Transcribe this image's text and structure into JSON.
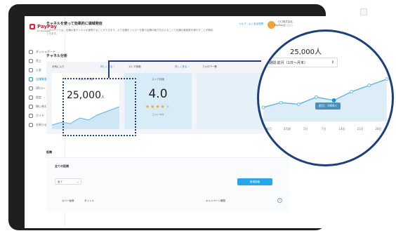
{
  "brand": {
    "name": "PayPay",
    "sub": "for Business"
  },
  "sidebar": {
    "items": [
      {
        "label": "ダッシュボード",
        "chevron": "⌄"
      },
      {
        "label": "売上"
      },
      {
        "label": "入金"
      },
      {
        "label": "店舗集客",
        "active": true
      },
      {
        "label": "QRコード"
      },
      {
        "label": "設定",
        "chevron": "⌄"
      },
      {
        "label": "問い合わせ"
      },
      {
        "label": "ガイド"
      },
      {
        "label": "お知らせ"
      }
    ]
  },
  "topbar": {
    "help": "ヘルプ・よくある質問",
    "user_line1": "〇〇株式会社",
    "user_line2": "PayPay店 ○○○"
  },
  "intro": {
    "title": "チャネルを使って効果的に領域発信",
    "desc": "このページでは、店舗の各チャネルを管理することができます。より店舗をフォローを集や店舗の魅力を伝えることで店舗の集客数を増やすことが期待できます。"
  },
  "analysis": {
    "title": "チャネル分析",
    "tabs": {
      "fav": "お気に入り",
      "fav_detail": "詳しく見る ›",
      "store": "ストア評価",
      "store_detail": "詳しく見る ›",
      "follow": "フォロワー数"
    },
    "favorites_card": {
      "label": "お気に入り数",
      "value": "25,000",
      "unit": "人"
    },
    "store_card": {
      "label": "ストア評価",
      "value": "4.0",
      "stars_on": "★★★★",
      "stars_off": "★",
      "sub": "口コミ 65件"
    },
    "colors": {
      "accent": "#1a8fd0",
      "focus": "#1e3f7c",
      "chart_line": "#5fb3dd"
    }
  },
  "posts": {
    "title": "投稿",
    "subtitle": "全ての投稿",
    "filter": "全て",
    "new_button": "新規投稿",
    "columns": [
      "カバー画像",
      "タイトル",
      "キャンペーン期間"
    ]
  },
  "magnified": {
    "value": "25,000人",
    "period_label": "期間:前月（1日〜月末）",
    "tooltip": "前月：1980人",
    "x_ticks": [
      "前月",
      "2月前",
      "1日",
      "7日",
      "14日",
      "21日",
      "28日"
    ]
  },
  "chart_data": {
    "type": "line",
    "title": "",
    "xlabel": "",
    "ylabel": "",
    "x": [
      "1",
      "2",
      "3",
      "4",
      "5",
      "6",
      "7",
      "8"
    ],
    "series": [
      {
        "values": [
          18,
          24,
          22,
          31,
          27,
          38,
          46,
          54
        ]
      }
    ],
    "ylim": [
      0,
      60
    ],
    "grid": false,
    "highlight_index": 4
  }
}
